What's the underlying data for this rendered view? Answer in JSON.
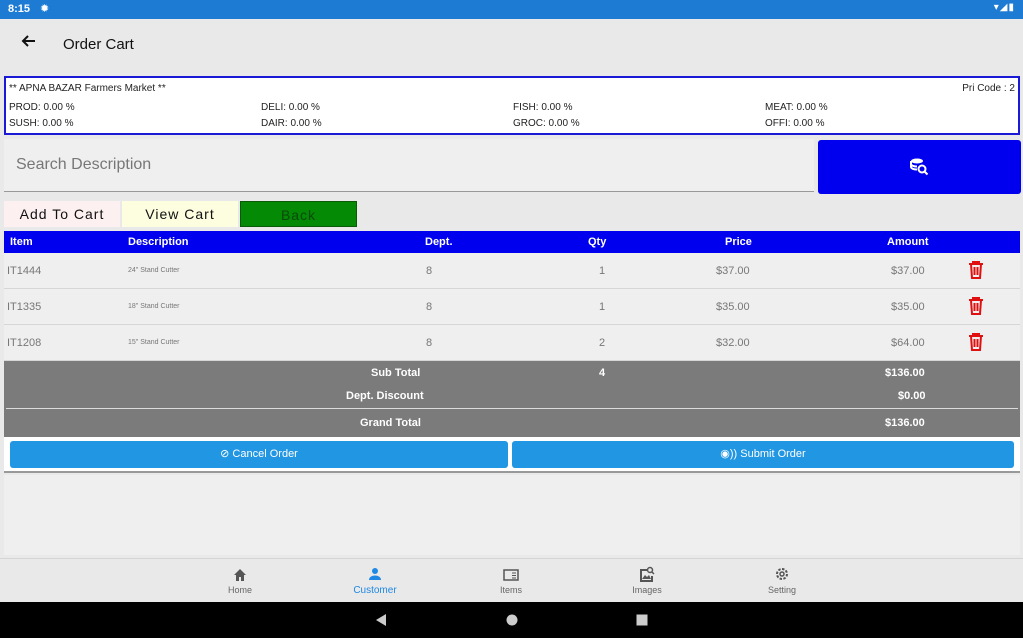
{
  "statusbar": {
    "time": "8:15",
    "gear_icon": "gear-icon",
    "right_icons": "▾◢▮"
  },
  "appbar": {
    "title": "Order Cart",
    "back_icon": "arrow-left-icon"
  },
  "info": {
    "store": "** APNA BAZAR Farmers Market **",
    "pri_code": "Pri Code : 2",
    "depts": [
      "PROD: 0.00 %",
      "DELI: 0.00 %",
      "FISH: 0.00 %",
      "MEAT: 0.00 %",
      "SUSH: 0.00 %",
      "DAIR: 0.00 %",
      "GROC: 0.00 %",
      "OFFI: 0.00 %"
    ]
  },
  "search": {
    "placeholder": "Search Description",
    "button_icon": "database-search-icon"
  },
  "actions": {
    "add_to_cart": "Add To Cart",
    "view_cart": "View Cart",
    "back": "Back"
  },
  "table": {
    "headers": [
      "Item",
      "Description",
      "Dept.",
      "Qty",
      "Price",
      "Amount"
    ],
    "rows": [
      {
        "item": "IT1444",
        "description": "24\" Stand Cutter",
        "dept": "8",
        "qty": "1",
        "price": "$37.00",
        "amount": "$37.00"
      },
      {
        "item": "IT1335",
        "description": "18\" Stand Cutter",
        "dept": "8",
        "qty": "1",
        "price": "$35.00",
        "amount": "$35.00"
      },
      {
        "item": "IT1208",
        "description": "15\" Stand Cutter",
        "dept": "8",
        "qty": "2",
        "price": "$32.00",
        "amount": "$64.00"
      }
    ],
    "delete_icon": "trash-icon"
  },
  "totals": {
    "sub_total_label": "Sub Total",
    "sub_total_qty": "4",
    "sub_total": "$136.00",
    "discount_label": "Dept. Discount",
    "discount": "$0.00",
    "grand_total_label": "Grand Total",
    "grand_total": "$136.00"
  },
  "order_buttons": {
    "cancel": "⊘ Cancel Order",
    "submit": "◉)) Submit Order"
  },
  "bottom_nav": [
    {
      "label": "Home",
      "icon": "home-icon"
    },
    {
      "label": "Customer",
      "icon": "person-icon",
      "active": true
    },
    {
      "label": "Items",
      "icon": "folder-icon"
    },
    {
      "label": "Images",
      "icon": "image-search-icon"
    },
    {
      "label": "Setting",
      "icon": "gear-icon"
    }
  ],
  "colors": {
    "primary": "#0000ee",
    "statusbar": "#1e7bd4",
    "accent": "#2196e3",
    "delete": "#e01010",
    "back_btn": "#058a05",
    "totals_bg": "#7b7b7b"
  }
}
